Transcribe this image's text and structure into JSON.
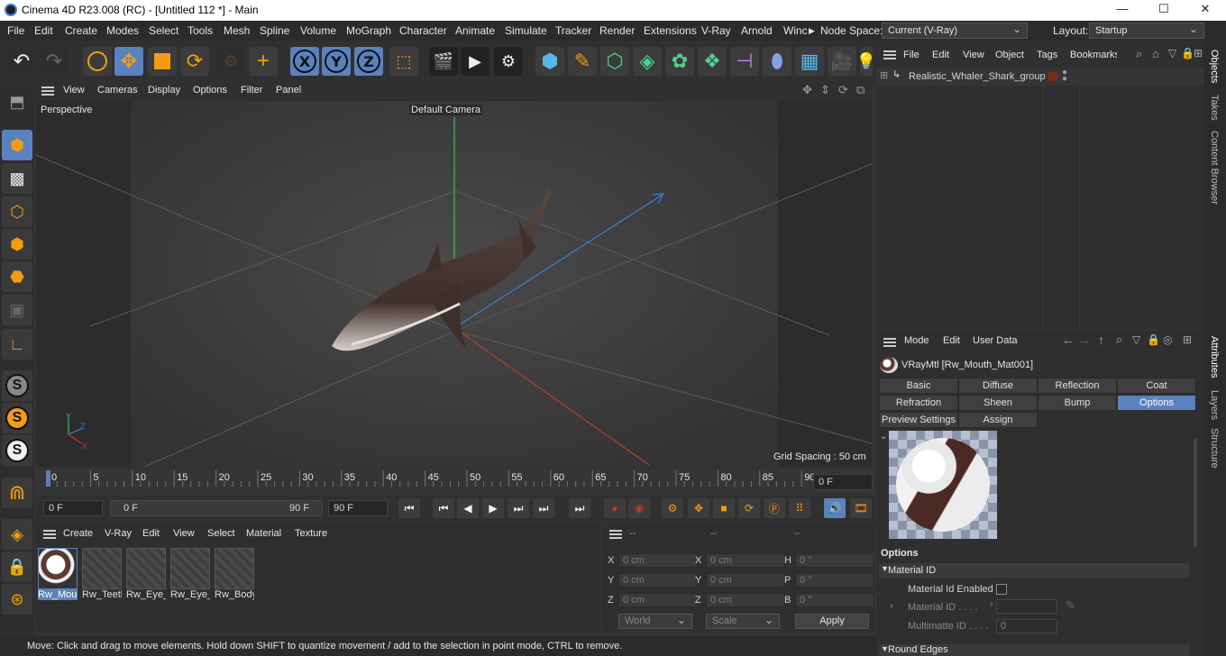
{
  "app": {
    "title": "Cinema 4D R23.008 (RC) - [Untitled 112 *] - Main"
  },
  "window_controls": {
    "minimize": "—",
    "maximize": "☐",
    "close": "✕"
  },
  "menu": [
    "File",
    "Edit",
    "Create",
    "Modes",
    "Select",
    "Tools",
    "Mesh",
    "Spline",
    "Volume",
    "MoGraph",
    "Character",
    "Animate",
    "Simulate",
    "Tracker",
    "Render",
    "Extensions",
    "V-Ray",
    "Arnold",
    "Winc"
  ],
  "node_space": {
    "label": "Node Space:",
    "value": "Current (V-Ray)"
  },
  "layout": {
    "label": "Layout:",
    "value": "Startup"
  },
  "axis_buttons": [
    "X",
    "Y",
    "Z"
  ],
  "viewport": {
    "menu": [
      "View",
      "Cameras",
      "Display",
      "Options",
      "Filter",
      "Panel"
    ],
    "label": "Perspective",
    "camera": "Default Camera",
    "grid_spacing": "Grid Spacing : 50 cm",
    "axis_labels": {
      "y": "Y",
      "z": "Z",
      "x": "X"
    }
  },
  "timeline": {
    "ticks": [
      "0",
      "5",
      "10",
      "15",
      "20",
      "25",
      "30",
      "35",
      "40",
      "45",
      "50",
      "55",
      "60",
      "65",
      "70",
      "75",
      "80",
      "85",
      "90"
    ],
    "current_frame": "0 F"
  },
  "transport": {
    "start": "0 F",
    "range_start": "0 F",
    "range_end": "90 F",
    "end": "90 F"
  },
  "material_manager": {
    "menu": [
      "Create",
      "V-Ray",
      "Edit",
      "View",
      "Select",
      "Material",
      "Texture"
    ],
    "materials": [
      "Rw_Mou",
      "Rw_Teetl",
      "Rw_Eye_",
      "Rw_Eye_",
      "Rw_Body"
    ]
  },
  "coordinates": {
    "headers": [
      "--",
      "--",
      "--"
    ],
    "rows": [
      {
        "a": "X",
        "av": "0 cm",
        "b": "X",
        "bv": "0 cm",
        "c": "H",
        "cv": "0 °"
      },
      {
        "a": "Y",
        "av": "0 cm",
        "b": "Y",
        "bv": "0 cm",
        "c": "P",
        "cv": "0 °"
      },
      {
        "a": "Z",
        "av": "0 cm",
        "b": "Z",
        "bv": "0 cm",
        "c": "B",
        "cv": "0 °"
      }
    ],
    "world": "World",
    "scale": "Scale",
    "apply": "Apply"
  },
  "status": "Move: Click and drag to move elements. Hold down SHIFT to quantize movement / add to the selection in point mode, CTRL to remove.",
  "object_manager": {
    "menu": [
      "File",
      "Edit",
      "View",
      "Object",
      "Tags",
      "Bookmarks"
    ],
    "object": "Realistic_Whaler_Shark_group"
  },
  "attribute_manager": {
    "menu": [
      "Mode",
      "Edit",
      "User Data"
    ],
    "title": "VRayMtl [Rw_Mouth_Mat001]",
    "tabs_row1": [
      "Basic",
      "Diffuse",
      "Reflection",
      "Coat"
    ],
    "tabs_row2": [
      "Refraction",
      "Sheen",
      "Bump",
      "Options"
    ],
    "tabs_row3": [
      "Preview Settings",
      "Assign"
    ],
    "section": "Options",
    "group": "Material ID",
    "mat_id_enabled": "Material Id Enabled",
    "material_id": "Material ID . . . .",
    "multimatte": "Multimatte ID . . . .",
    "multimatte_value": "0",
    "round_edges": "Round Edges"
  },
  "right_strip": [
    "Objects",
    "Takes",
    "Content Browser",
    "Attributes",
    "Layers",
    "Structure"
  ],
  "colors": {
    "accent": "#5a82bd",
    "orange": "#f39c12",
    "bg": "#333333"
  }
}
